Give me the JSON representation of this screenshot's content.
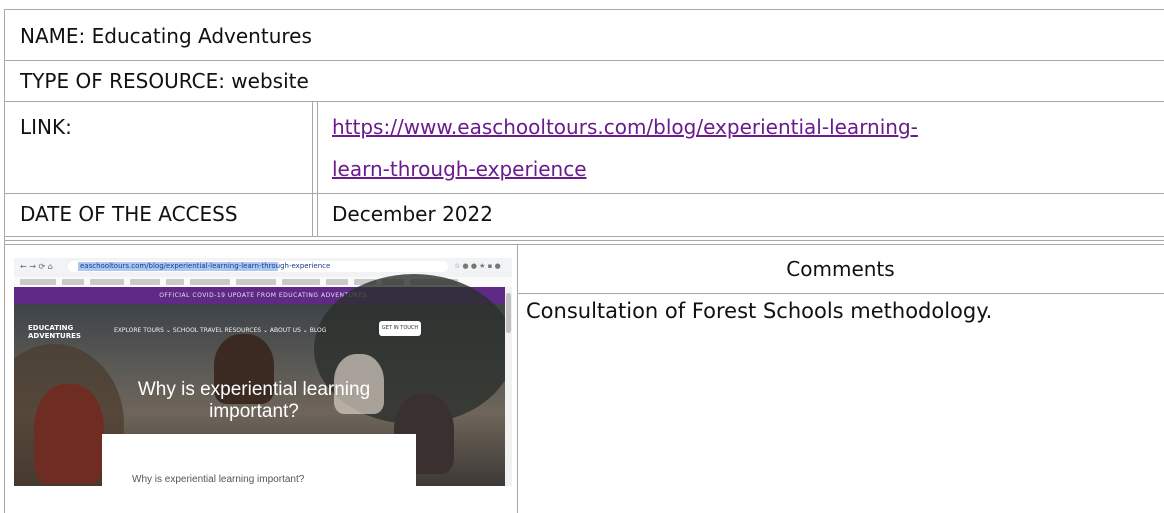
{
  "rows": {
    "name": "NAME: Educating Adventures",
    "type": "TYPE OF RESOURCE: website",
    "link_label": "LINK:",
    "link_line1": "https://www.easchooltours.com/blog/experiential-learning-",
    "link_line2": "learn-through-experience",
    "date_label": "DATE OF THE ACCESS",
    "date_value": "December 2022"
  },
  "comments": {
    "header": "Comments",
    "body": "Consultation of Forest Schools methodology."
  },
  "screenshot": {
    "url": "easchooltours.com/blog/experiential-learning-learn-through-experience",
    "banner": "OFFICIAL COVID-19 UPDATE FROM EDUCATING ADVENTURES",
    "logo_line1": "EDUCATING",
    "logo_line2": "ADVENTURES",
    "nav": "EXPLORE TOURS ⌄   SCHOOL TRAVEL RESOURCES ⌄   ABOUT US ⌄   BLOG",
    "cta": "GET IN TOUCH",
    "hero_title": "Why is experiential learning important?",
    "card_text": "Why is experiential learning important?"
  },
  "colors": {
    "link": "#6b1b8e",
    "banner": "#5e2a86",
    "border": "#a8a8a8"
  }
}
